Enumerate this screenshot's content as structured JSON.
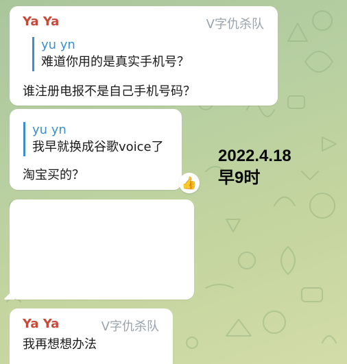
{
  "messages": [
    {
      "sender": "Ya Ya",
      "title": "V字仇杀队",
      "reply": {
        "author": "yu yn",
        "text": "难道你用的是真实手机号？"
      },
      "text": "谁注册电报不是自己手机号码？"
    },
    {
      "reply": {
        "author": "yu yn",
        "text": "我早就换成谷歌voice了"
      },
      "text": "淘宝买的？",
      "reaction": "👍"
    },
    {
      "text": ""
    },
    {
      "sender": "Ya Ya",
      "title": "V字仇杀队",
      "text": "我再想想办法"
    }
  ],
  "overlay": {
    "line1": "2022.4.18",
    "line2": "早9时"
  },
  "colors": {
    "sender_name": "#c64a3a",
    "title_tag": "#9aa3ab",
    "reply_accent": "#3a8fd0",
    "bubble": "#ffffff"
  }
}
